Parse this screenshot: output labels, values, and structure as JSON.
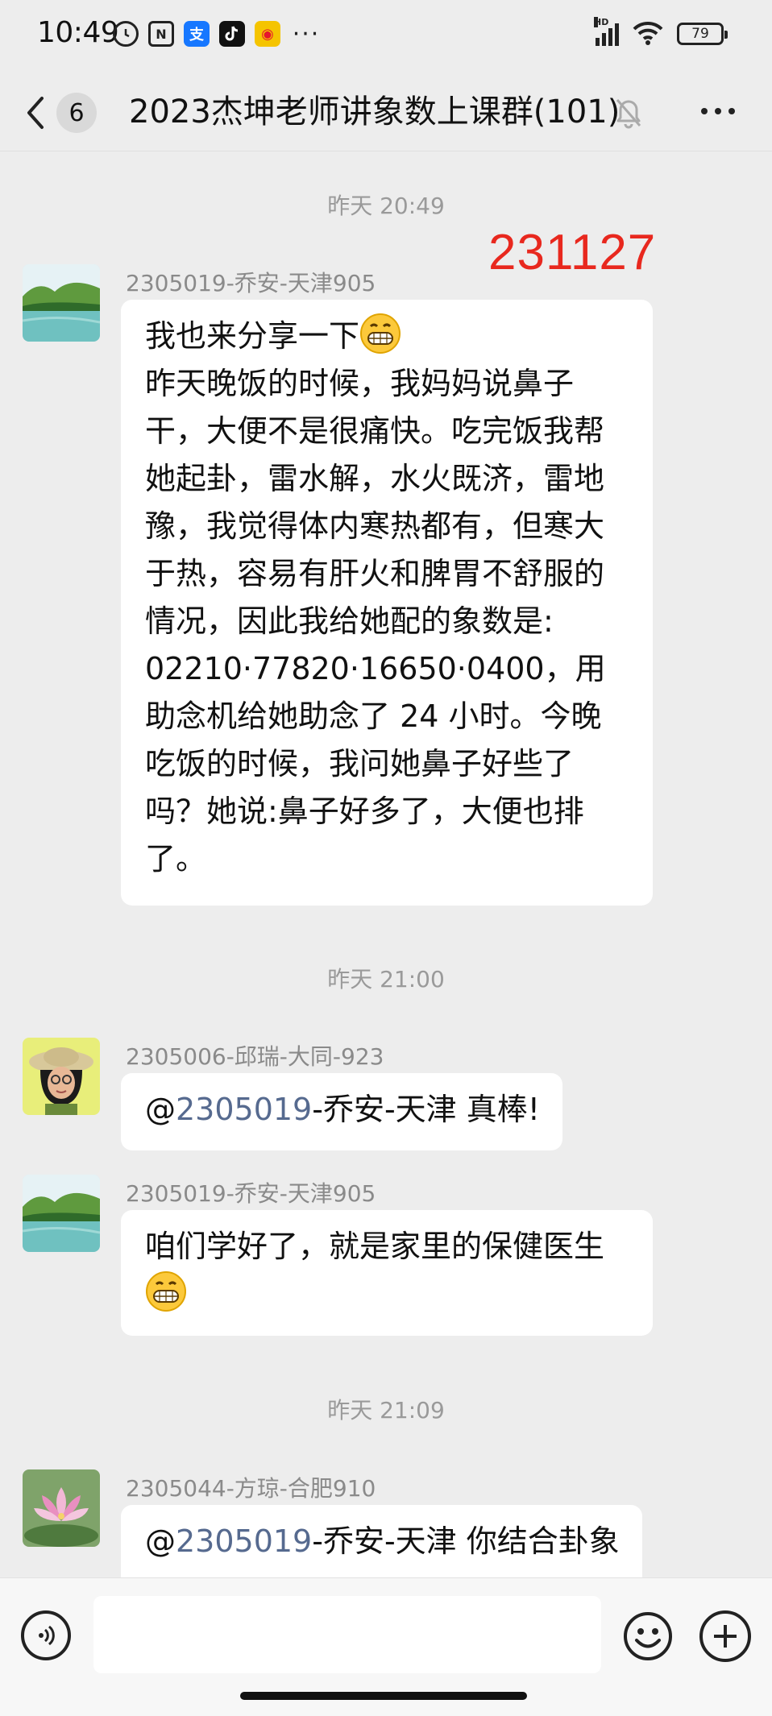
{
  "status_bar": {
    "time": "10:49",
    "left_icons": [
      "alarm-icon",
      "nfc-icon",
      "alipay-icon",
      "tiktok-icon",
      "weibo-icon",
      "more-dots-icon"
    ],
    "network_label": "HD",
    "battery": "79"
  },
  "nav": {
    "unread_count": "6",
    "title": "2023杰坤老师讲象数上课群(101)"
  },
  "annotation": "231127",
  "timestamps": [
    "昨天 20:49",
    "昨天 21:00",
    "昨天 21:09"
  ],
  "messages": [
    {
      "sender": "2305019-乔安-天津905",
      "lines": [
        "我也来分享一下",
        "昨天晚饭的时候，我妈妈说鼻子",
        "干，大便不是很痛快。吃完饭我帮",
        "她起卦，雷水解，水火既济，雷地",
        "豫，我觉得体内寒热都有，但寒大",
        "于热，容易有肝火和脾胃不舒服的",
        "情况，因此我给她配的象数是:",
        "02210·77820·16650·0400，用",
        "助念机给她助念了 24 小时。今晚",
        "吃饭的时候，我问她鼻子好些了",
        "吗？她说:鼻子好多了，大便也排",
        "了。"
      ]
    },
    {
      "sender": "2305006-邱瑞-大同-923",
      "mention_prefix": "@",
      "mention": "2305019",
      "text": "-乔安-天津  真棒!"
    },
    {
      "sender": "2305019-乔安-天津905",
      "text": "咱们学好了，就是家里的保健医生"
    },
    {
      "sender": "2305044-方琼-合肥910",
      "mention_prefix": "@",
      "mention": "2305019",
      "text": "-乔安-天津  你结合卦象"
    }
  ],
  "colors": {
    "background": "#ededed",
    "bubble": "#ffffff",
    "mention": "#566a8f",
    "annotation": "#e8281e",
    "timestamp": "#9a9a9a"
  }
}
